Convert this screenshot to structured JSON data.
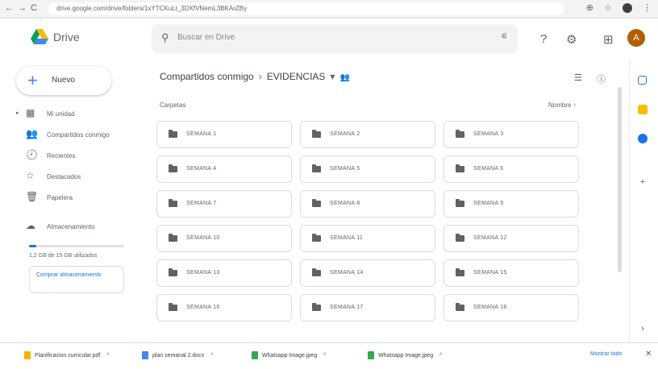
{
  "browser": {
    "url": "drive.google.com/drive/folders/1xYTCKuLt_3DXfVNemL3BKArZBy",
    "back": "←",
    "forward": "→",
    "reload": "C"
  },
  "app": {
    "name": "Drive"
  },
  "search": {
    "placeholder": "Buscar en Drive"
  },
  "user": {
    "initial": "A"
  },
  "new_button": {
    "label": "Nuevo"
  },
  "sidebar": {
    "items": [
      {
        "label": "Mi unidad",
        "icon": "▦"
      },
      {
        "label": "Compartidos conmigo",
        "icon": "👥"
      },
      {
        "label": "Recientes",
        "icon": "🕘"
      },
      {
        "label": "Destacados",
        "icon": "☆"
      },
      {
        "label": "Papelera",
        "icon": "🗑"
      },
      {
        "label": "Almacenamiento",
        "icon": "☁"
      }
    ],
    "storage_fraction": 0.08,
    "storage_text": "1,2 GB de 15 GB utilizados",
    "storage_button": "Comprar almacenamiento"
  },
  "breadcrumb": {
    "parent": "Compartidos conmigo",
    "current": "EVIDENCIAS"
  },
  "section": {
    "label": "Carpetas",
    "sort": "Nombre"
  },
  "folders": [
    "SEMANA 1",
    "SEMANA 2",
    "SEMANA 3",
    "SEMANA 4",
    "SEMANA 5",
    "SEMANA 6",
    "SEMANA 7",
    "SEMANA 8",
    "SEMANA 9",
    "SEMANA 10",
    "SEMANA 11",
    "SEMANA 12",
    "SEMANA 13",
    "SEMANA 14",
    "SEMANA 15",
    "SEMANA 16",
    "SEMANA 17",
    "SEMANA 18"
  ],
  "downloads": [
    {
      "name": "Planificacion curricular.pdf",
      "color": "#f4b400"
    },
    {
      "name": "plan semanal 2.docx",
      "color": "#4285f4"
    },
    {
      "name": "Whatsapp Image.jpeg",
      "color": "#34a853"
    },
    {
      "name": "Whatsapp Image.jpeg",
      "color": "#34a853"
    }
  ],
  "show_all": "Mostrar todo",
  "colors": {
    "accent": "#1a73e8",
    "avatar": "#b06000"
  }
}
